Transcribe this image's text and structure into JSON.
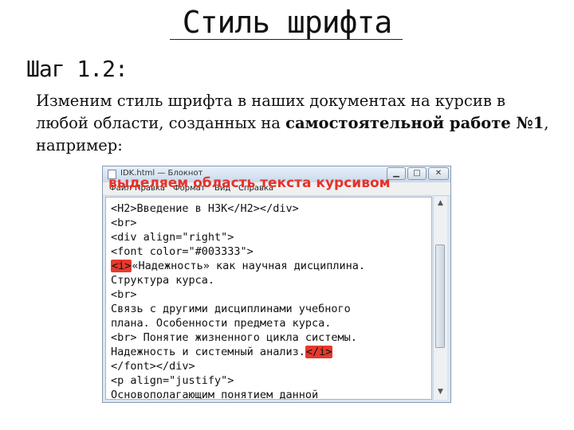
{
  "slide": {
    "title": "Стиль шрифта",
    "step": "Шаг 1.2:",
    "text_part1": "Изменим стиль шрифта в наших документах на курсив в любой области, созданных на ",
    "text_bold": "самостоятельной работе №1",
    "text_part2": ", например:"
  },
  "window": {
    "title": "IDK.html — Блокнот",
    "menu": [
      "Файл",
      "Правка",
      "Формат",
      "Вид",
      "Справка"
    ],
    "minimize_glyph": "▁",
    "maximize_glyph": "□",
    "close_glyph": "✕",
    "overlay_label": "выделяем область текста курсивом"
  },
  "editor": {
    "lines": [
      "<H2>Введение в НЗК</H2></div>",
      "<br>",
      "<div align=\"right\">",
      "<font color=\"#003333\">",
      "«Надежность» как научная дисциплина.",
      "Структура курса.",
      "<br>",
      "Связь с другими дисциплинами учебного",
      "плана. Особенности предмета курса.",
      "<br> Понятие жизненного цикла системы.",
      "Надежность и системный анализ.",
      "</font></div>",
      "<p align=\"justify\">",
      "Основополагающим понятием данной"
    ],
    "open_tag": "<i>",
    "close_tag": "</i>"
  },
  "colors": {
    "highlight": "#e53a2d",
    "overlay_text": "#e5332a"
  },
  "icons": {
    "scroll_up": "scroll-up-arrow-icon",
    "scroll_down": "scroll-down-arrow-icon"
  }
}
